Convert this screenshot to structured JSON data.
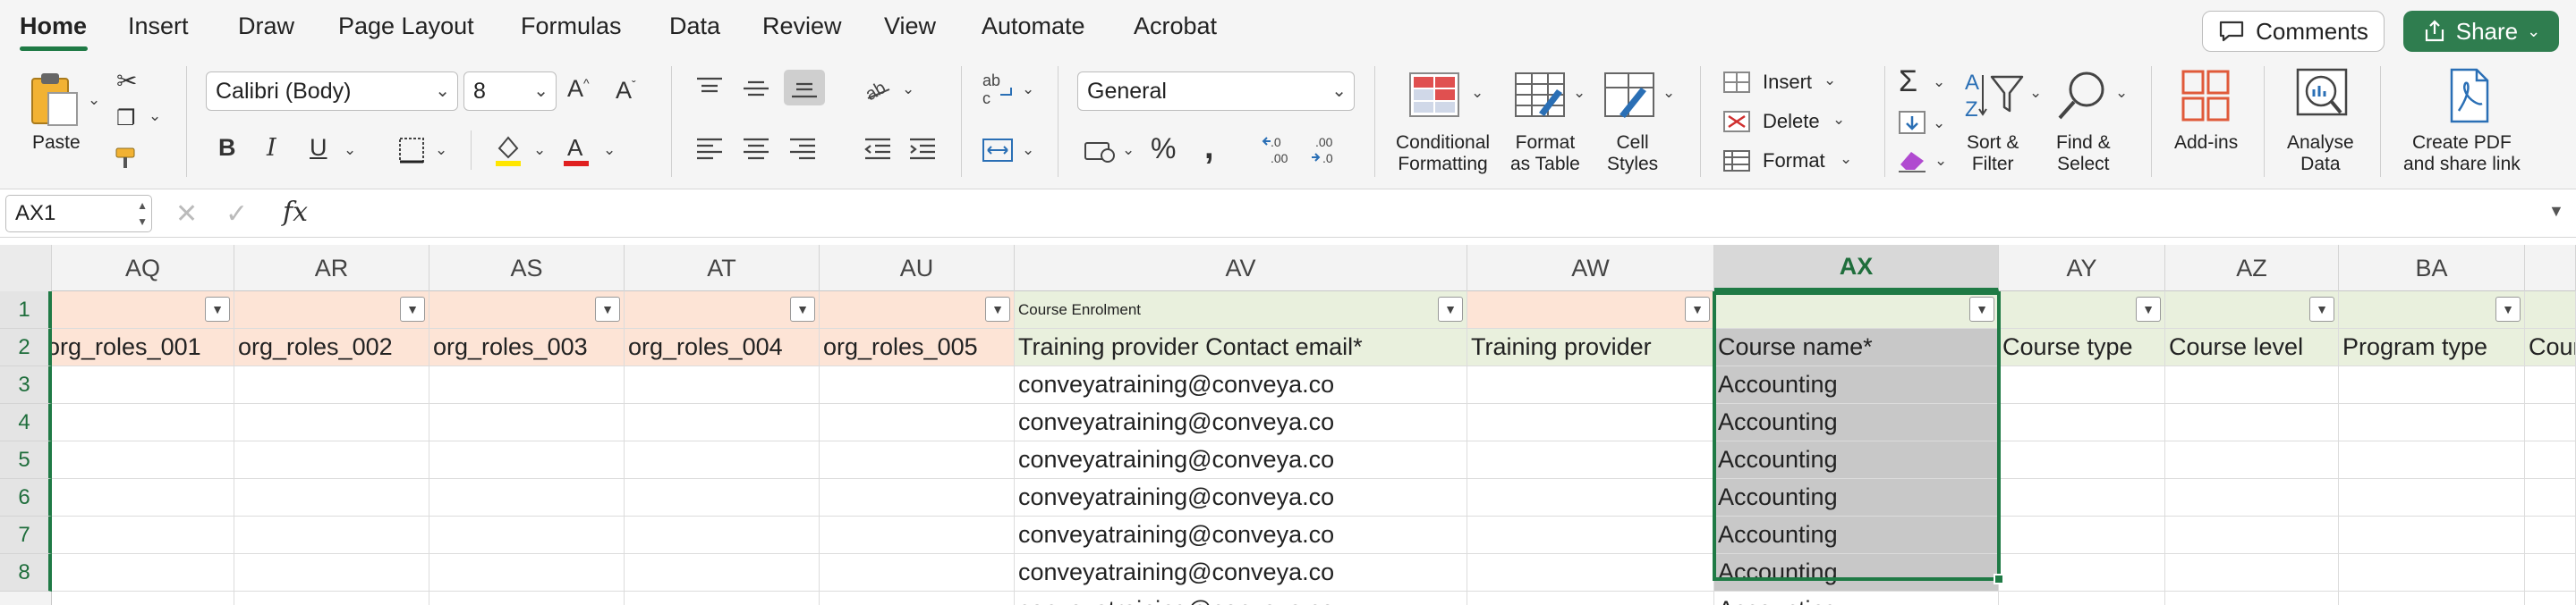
{
  "menu": {
    "items": [
      "Home",
      "Insert",
      "Draw",
      "Page Layout",
      "Formulas",
      "Data",
      "Review",
      "View",
      "Automate",
      "Acrobat"
    ],
    "comments_label": "Comments",
    "share_label": "Share"
  },
  "ribbon": {
    "paste_label": "Paste",
    "font_name": "Calibri (Body)",
    "font_size": "8",
    "number_format": "General",
    "conditional_formatting_label": "Conditional\nFormatting",
    "format_as_table_label": "Format\nas Table",
    "cell_styles_label": "Cell\nStyles",
    "insert_label": "Insert",
    "delete_label": "Delete",
    "format_label": "Format",
    "sort_filter_label": "Sort &\nFilter",
    "find_select_label": "Find &\nSelect",
    "addins_label": "Add-ins",
    "analyse_data_label": "Analyse\nData",
    "create_pdf_label": "Create PDF\nand share link",
    "bold": "B",
    "italic": "I",
    "underline": "U",
    "accent_color": "#1f7a45",
    "highlight_color": "#ffe600",
    "font_color": "#e02020"
  },
  "formula_bar": {
    "name_box": "AX1",
    "fx_label": "fx",
    "formula": ""
  },
  "grid": {
    "columns": [
      "AQ",
      "AR",
      "AS",
      "AT",
      "AU",
      "AV",
      "AW",
      "AX",
      "AY",
      "AZ",
      "BA"
    ],
    "rows": [
      "1",
      "2",
      "3",
      "4",
      "5",
      "6",
      "7",
      "8"
    ],
    "group_header_AV": "Course Enrolment",
    "headers": [
      "org_roles_001",
      "org_roles_002",
      "org_roles_003",
      "org_roles_004",
      "org_roles_005",
      "Training provider Contact email*",
      "Training provider",
      "Course name*",
      "Course type",
      "Course level",
      "Program type",
      "Cour"
    ],
    "email": "conveyatraining@conveya.co",
    "course": "Accounting",
    "selected_column": "AX"
  }
}
